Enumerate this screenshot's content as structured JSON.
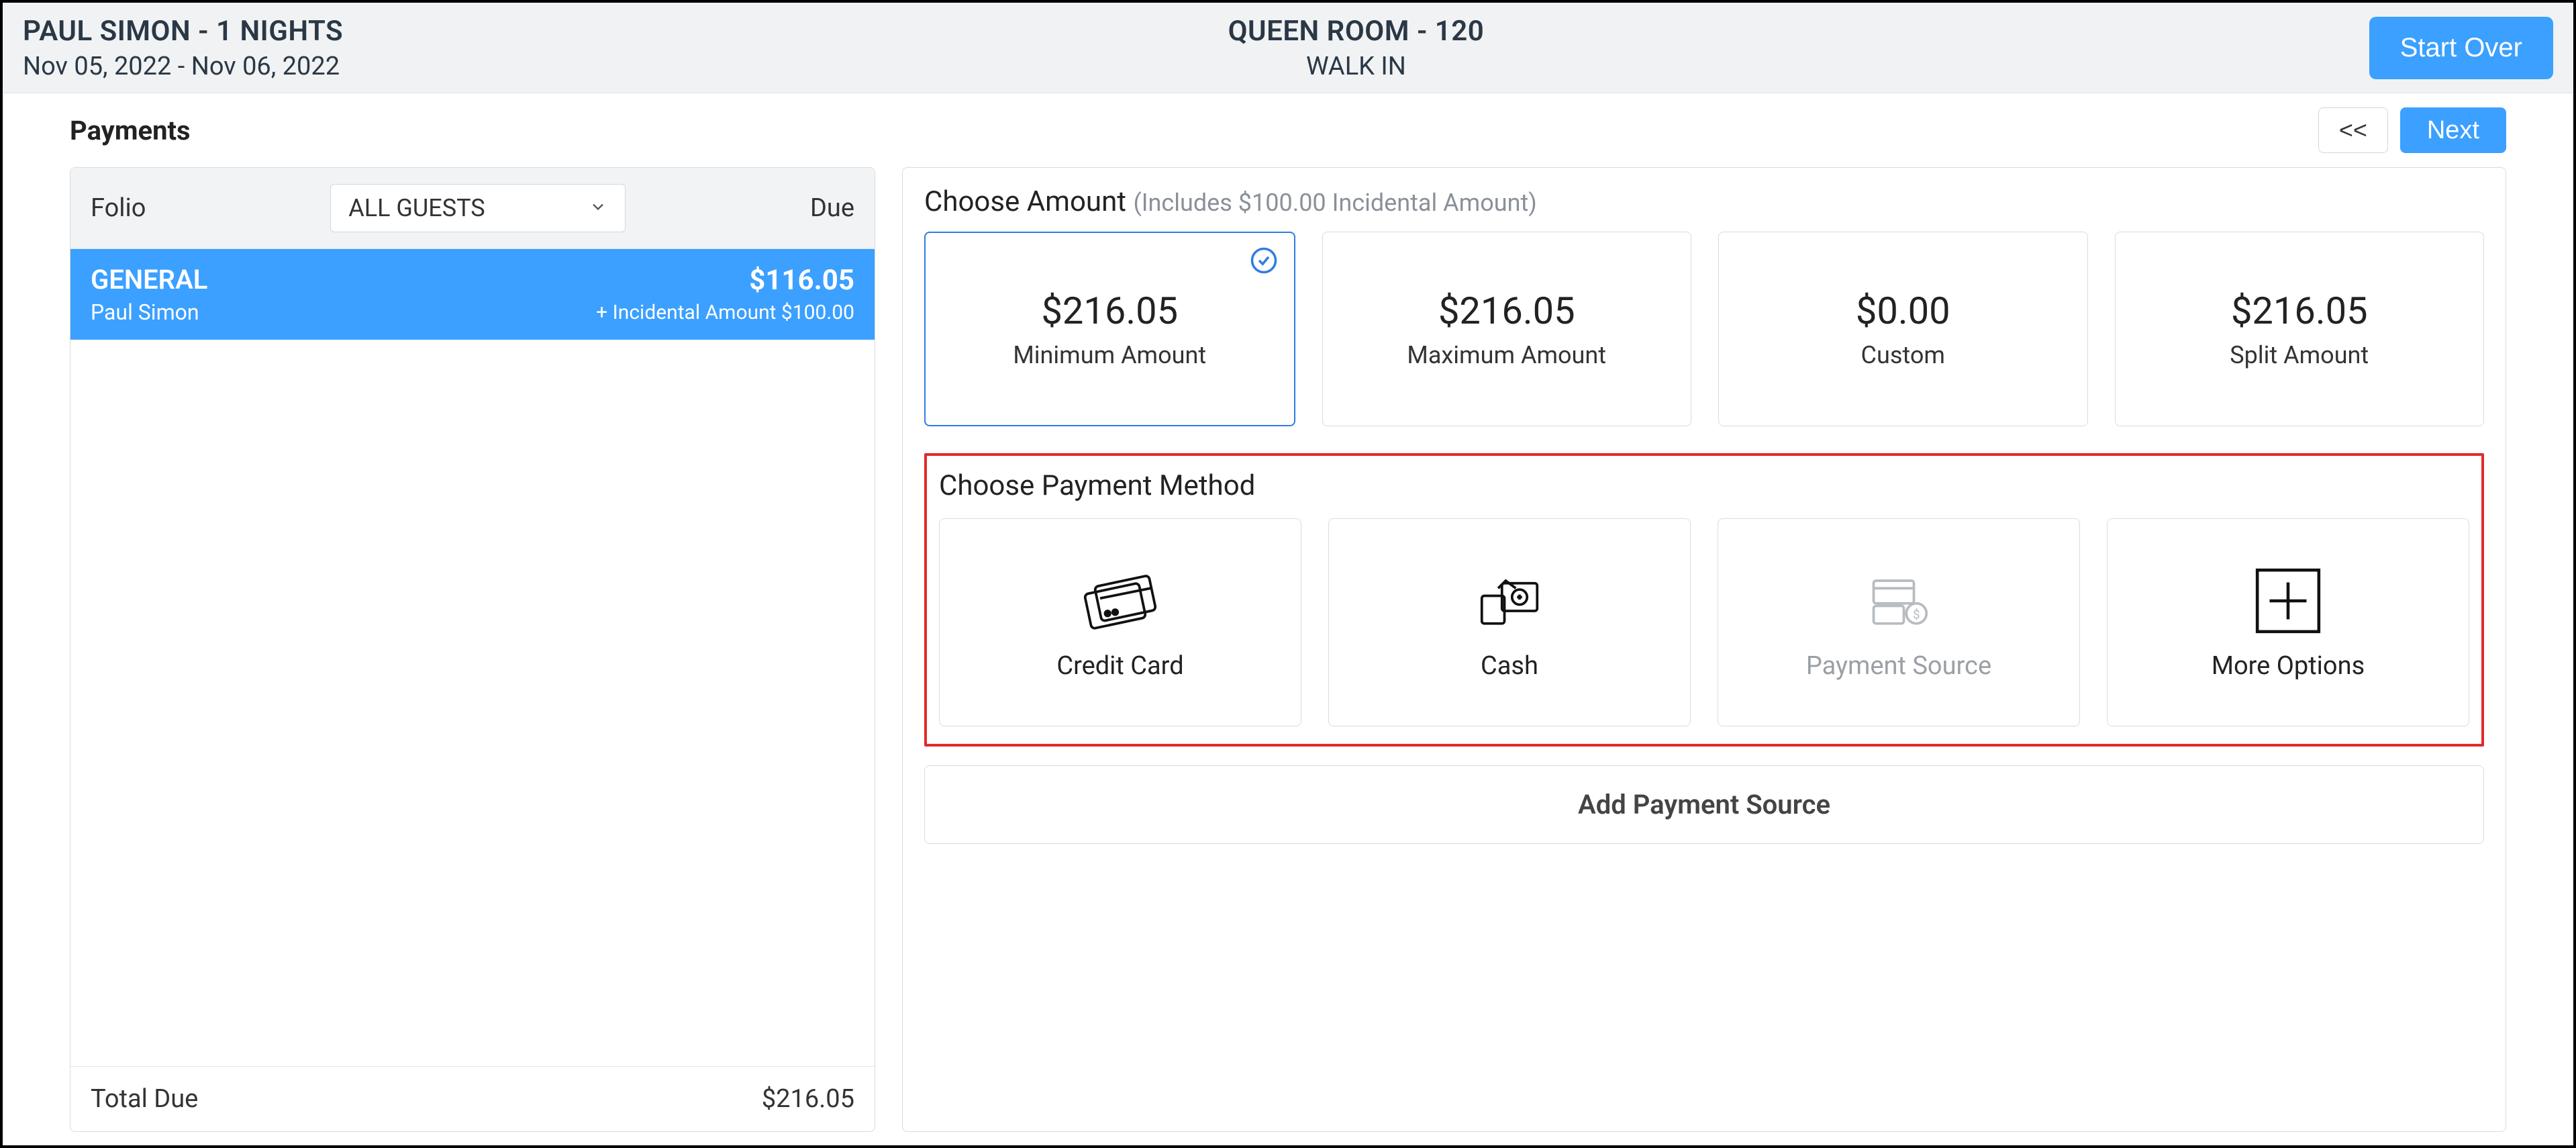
{
  "header": {
    "guest_nights": "PAUL SIMON - 1 NIGHTS",
    "date_range": "Nov 05, 2022 - Nov 06, 2022",
    "room": "QUEEN ROOM - 120",
    "source": "WALK IN",
    "start_over": "Start Over"
  },
  "subbar": {
    "title": "Payments",
    "back": "<<",
    "next": "Next"
  },
  "folio": {
    "folio_label": "Folio",
    "due_label": "Due",
    "guest_selector": "ALL GUESTS",
    "item": {
      "name": "GENERAL",
      "guest": "Paul Simon",
      "amount": "$116.05",
      "incidental": "+ Incidental Amount $100.00"
    },
    "total_label": "Total Due",
    "total_value": "$216.05"
  },
  "amounts": {
    "title": "Choose Amount",
    "sub": "(Includes $100.00 Incidental Amount)",
    "cards": {
      "min": {
        "value": "$216.05",
        "label": "Minimum Amount"
      },
      "max": {
        "value": "$216.05",
        "label": "Maximum Amount"
      },
      "custom": {
        "value": "$0.00",
        "label": "Custom"
      },
      "split": {
        "value": "$216.05",
        "label": "Split Amount"
      }
    }
  },
  "methods": {
    "title": "Choose Payment Method",
    "credit": "Credit Card",
    "cash": "Cash",
    "source": "Payment Source",
    "more": "More Options"
  },
  "add_source": "Add Payment Source"
}
